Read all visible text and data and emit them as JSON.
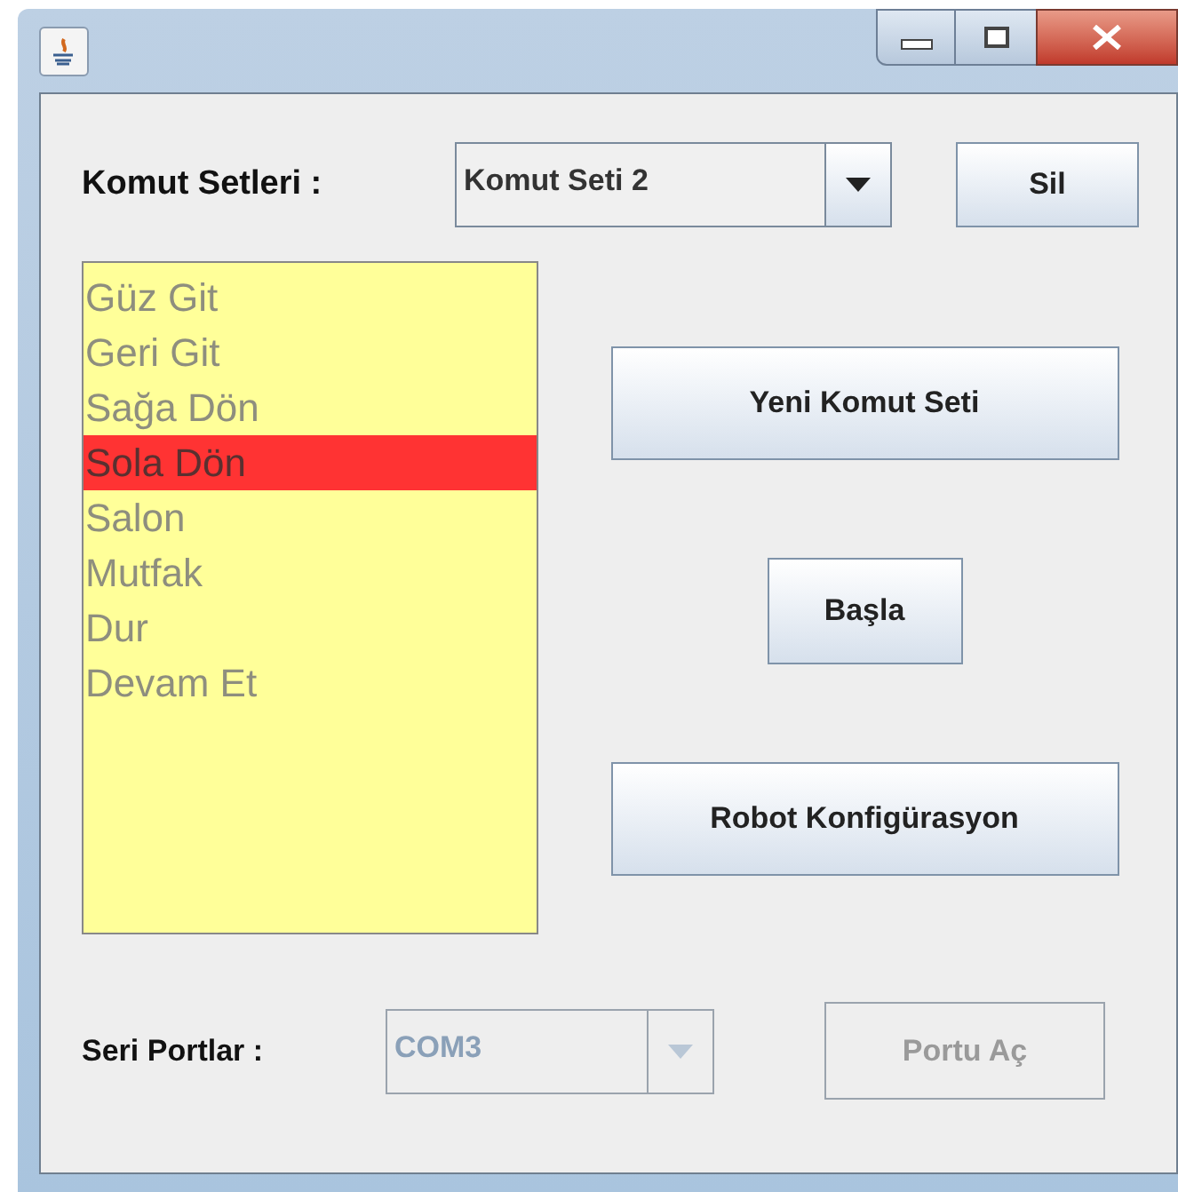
{
  "command_sets": {
    "label": "Komut Setleri :",
    "value": "Komut Seti 2",
    "delete_button": "Sil"
  },
  "commands": [
    {
      "label": "Güz Git",
      "selected": false
    },
    {
      "label": "Geri Git",
      "selected": false
    },
    {
      "label": "Sağa Dön",
      "selected": false
    },
    {
      "label": "Sola Dön",
      "selected": true
    },
    {
      "label": "Salon",
      "selected": false
    },
    {
      "label": "Mutfak",
      "selected": false
    },
    {
      "label": "Dur",
      "selected": false
    },
    {
      "label": "Devam Et",
      "selected": false
    }
  ],
  "actions": [
    {
      "label": "Yeni Komut Seti",
      "kind": "wide"
    },
    {
      "label": "Başla",
      "kind": "narrow"
    },
    {
      "label": "Robot Konfigürasyon",
      "kind": "wide"
    }
  ],
  "serial_ports": {
    "label": "Seri Portlar :",
    "value": "COM3",
    "disabled": true,
    "open_button": {
      "label": "Portu Aç",
      "disabled": true
    }
  }
}
